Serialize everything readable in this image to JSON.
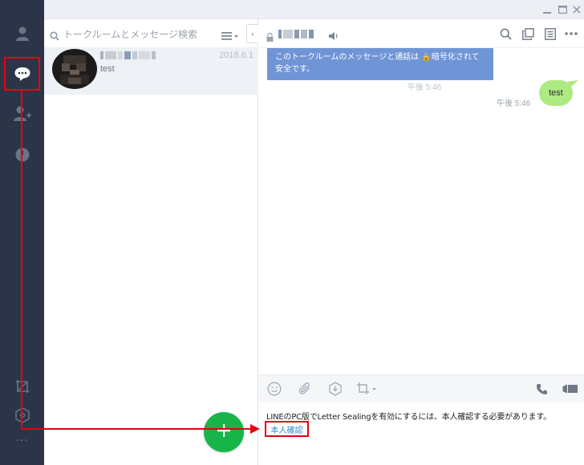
{
  "window": {
    "minimize_label": "‗",
    "maximize_label": "□",
    "close_label": "✕"
  },
  "rail": {
    "items": [
      "profile-icon",
      "chats-icon",
      "add-friend-icon",
      "timeline-icon",
      "keep-icon",
      "settings-icon",
      "more-icon"
    ],
    "more_label": "···",
    "active_color": "#ffffff",
    "inactive_color": "#6b7486"
  },
  "search": {
    "placeholder": "トークルームとメッセージ検索",
    "collapse_label": "‹"
  },
  "chat_list": {
    "items": [
      {
        "preview": "test",
        "date": "2018.6.1"
      }
    ]
  },
  "chat": {
    "notice": "このトークルームのメッセージと通話は 🔒暗号化されて安全です。",
    "notice_peek": "午後 5:46",
    "message": {
      "text": "test",
      "time": "午後 5:46"
    },
    "sealing_warning": "LINEのPC版でLetter Sealingを有効にするには、本人確認する必要があります。",
    "verify_link": "本人確認"
  },
  "colors": {
    "accent_green": "#17b44a",
    "bubble_green": "#aeea82",
    "notice_blue": "#6f95d6",
    "annotation_red": "#e60012",
    "rail_bg": "#2c3547"
  }
}
